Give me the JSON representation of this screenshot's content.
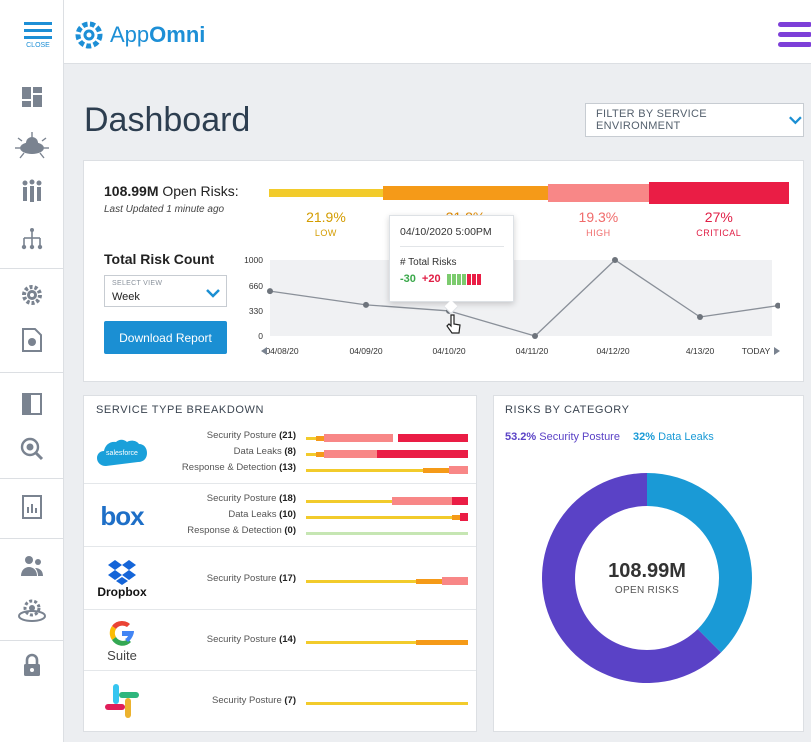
{
  "app": {
    "brand_prefix": "App",
    "brand_suffix": "Omni",
    "close_label": "CLOSE"
  },
  "page": {
    "title": "Dashboard",
    "filter_label": "FILTER BY SERVICE ENVIRONMENT"
  },
  "summary": {
    "open_risks_value": "108.99M",
    "open_risks_label": " Open Risks:",
    "last_updated": "Last Updated 1 minute ago",
    "levels": [
      {
        "pct": "21.9%",
        "label": "LOW",
        "share": 21.9,
        "color": "#f2cb2b",
        "text_color": "#d39c00"
      },
      {
        "pct": "31.8%",
        "label": "MEDIUM",
        "share": 31.8,
        "color": "#f59a18",
        "text_color": "#e08a00"
      },
      {
        "pct": "19.3%",
        "label": "HIGH",
        "share": 19.3,
        "color": "#f88787",
        "text_color": "#f06b6b"
      },
      {
        "pct": "27%",
        "label": "CRITICAL",
        "share": 27,
        "color": "#ea1d45",
        "text_color": "#e01e45"
      }
    ]
  },
  "trend": {
    "title": "Total Risk Count",
    "select_caption": "SELECT VIEW",
    "select_value": "Week",
    "download_label": "Download Report",
    "tooltip": {
      "date": "04/10/2020 5:00PM",
      "heading": "# Total Risks",
      "minus": "-30",
      "plus": "+20"
    }
  },
  "chart_data": {
    "type": "line",
    "x": [
      "04/08/20",
      "04/09/20",
      "04/10/20",
      "04/11/20",
      "04/12/20",
      "4/13/20",
      "TODAY"
    ],
    "values": [
      590,
      410,
      330,
      0,
      1000,
      250,
      400
    ],
    "yticks": [
      "1000",
      "660",
      "330",
      "0"
    ],
    "ylim": [
      0,
      1000
    ]
  },
  "services": {
    "title": "SERVICE TYPE BREAKDOWN",
    "rows": [
      {
        "name": "salesforce",
        "bars": [
          {
            "label": "Security Posture",
            "count": "(21)",
            "segs": [
              [
                0,
                "#f2cb2b",
                0.06
              ],
              [
                0.06,
                "#f59a18",
                0.05
              ],
              [
                0.11,
                "#f88787",
                0.43
              ],
              [
                0.57,
                "#ea1d45",
                0.43
              ]
            ]
          },
          {
            "label": "Data Leaks",
            "count": "(8)",
            "segs": [
              [
                0,
                "#f2cb2b",
                0.06
              ],
              [
                0.06,
                "#f59a18",
                0.05
              ],
              [
                0.11,
                "#f88787",
                0.33
              ],
              [
                0.44,
                "#ea1d45",
                0.56
              ]
            ]
          },
          {
            "label": "Response & Detection",
            "count": "(13)",
            "segs": [
              [
                0,
                "#f2cb2b",
                0.5
              ],
              [
                0.5,
                "#f2cb2b",
                0.22
              ],
              [
                0.72,
                "#f59a18",
                0.16
              ],
              [
                0.88,
                "#f88787",
                0.12
              ]
            ]
          }
        ]
      },
      {
        "name": "box",
        "bars": [
          {
            "label": "Security Posture",
            "count": "(18)",
            "segs": [
              [
                0,
                "#f2cb2b",
                0.53
              ],
              [
                0.53,
                "#f88787",
                0.37
              ],
              [
                0.9,
                "#ea1d45",
                0.1
              ]
            ]
          },
          {
            "label": "Data Leaks",
            "count": "(10)",
            "segs": [
              [
                0,
                "#f2cb2b",
                0.9
              ],
              [
                0.9,
                "#f59a18",
                0.05
              ],
              [
                0.95,
                "#ea1d45",
                0.05
              ]
            ]
          },
          {
            "label": "Response & Detection",
            "count": "(0)",
            "segs": [
              [
                0,
                "#c6e6b3",
                1
              ]
            ]
          }
        ]
      },
      {
        "name": "Dropbox",
        "bars": [
          {
            "label": "Security Posture",
            "count": "(17)",
            "segs": [
              [
                0,
                "#f2cb2b",
                0.68
              ],
              [
                0.68,
                "#f59a18",
                0.16
              ],
              [
                0.84,
                "#f88787",
                0.16
              ]
            ]
          }
        ]
      },
      {
        "name": "Suite",
        "bars": [
          {
            "label": "Security Posture",
            "count": "(14)",
            "segs": [
              [
                0,
                "#f2cb2b",
                0.68
              ],
              [
                0.68,
                "#f59a18",
                0.32
              ]
            ]
          }
        ]
      },
      {
        "name": "slack",
        "bars": [
          {
            "label": "Security Posture",
            "count": "(7)",
            "segs": [
              [
                0,
                "#f2cb2b",
                1
              ]
            ]
          }
        ]
      }
    ]
  },
  "categories": {
    "title": "RISKS BY CATEGORY",
    "items": [
      {
        "pct": "53.2%",
        "label": "Security Posture",
        "value": 53.2,
        "color": "#5a42c6"
      },
      {
        "pct": "32%",
        "label": "Data Leaks",
        "value": 32,
        "color": "#1a9ad6"
      }
    ],
    "center_value": "108.99M",
    "center_label": "OPEN RISKS"
  }
}
